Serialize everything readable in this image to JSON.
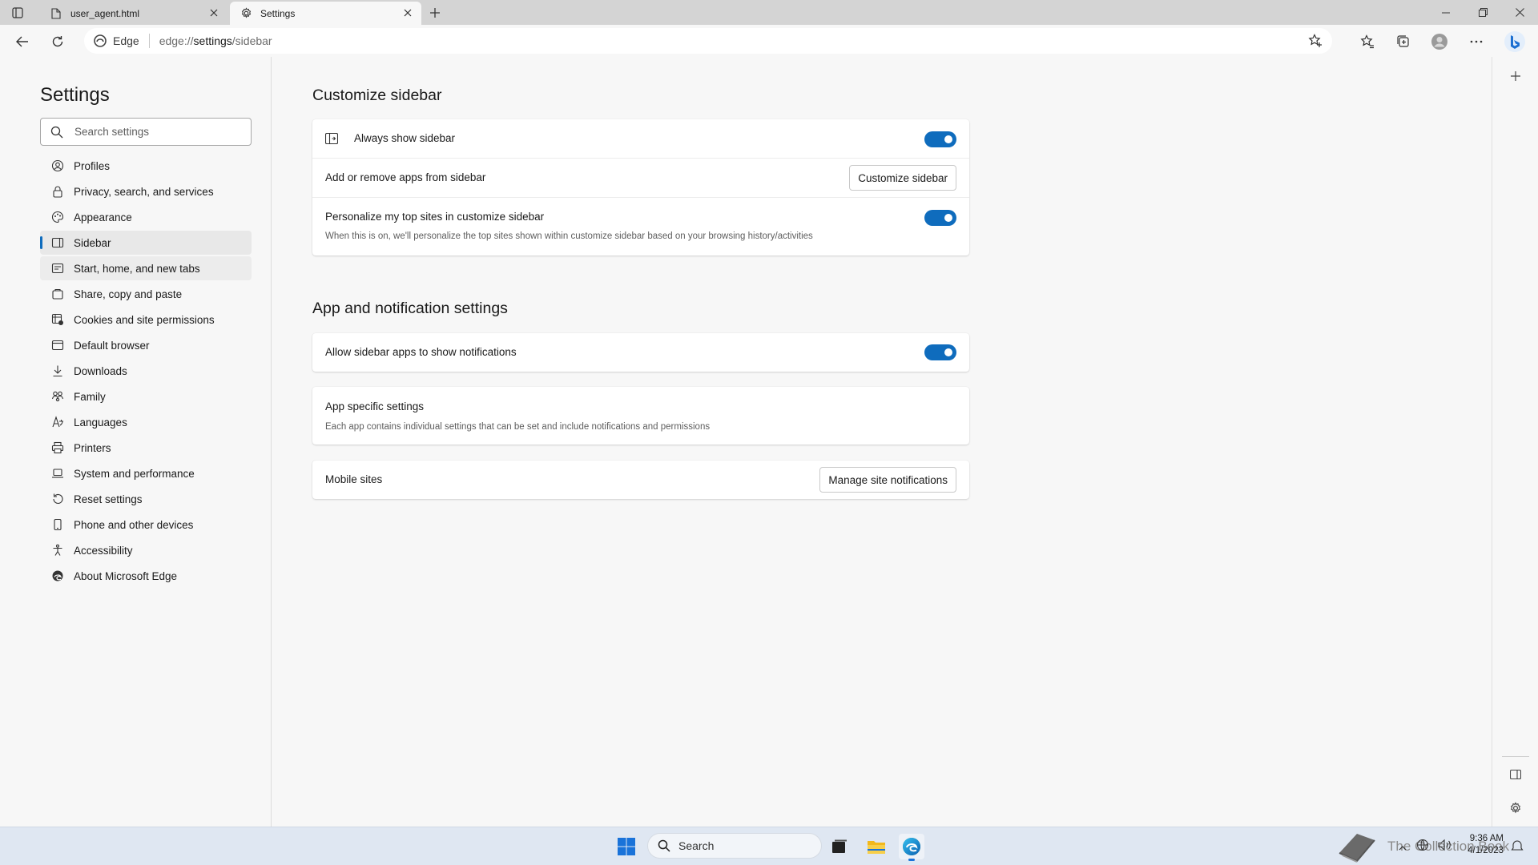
{
  "tabs": [
    {
      "title": "user_agent.html"
    },
    {
      "title": "Settings"
    }
  ],
  "toolbar": {
    "browser_label": "Edge",
    "url_prefix": "edge://",
    "url_host": "settings",
    "url_path": "/sidebar"
  },
  "nav": {
    "title": "Settings",
    "search_placeholder": "Search settings",
    "items": [
      {
        "label": "Profiles",
        "icon": "profile-icon"
      },
      {
        "label": "Privacy, search, and services",
        "icon": "lock-icon"
      },
      {
        "label": "Appearance",
        "icon": "palette-icon"
      },
      {
        "label": "Sidebar",
        "icon": "sidebar-icon"
      },
      {
        "label": "Start, home, and new tabs",
        "icon": "home-icon"
      },
      {
        "label": "Share, copy and paste",
        "icon": "share-icon"
      },
      {
        "label": "Cookies and site permissions",
        "icon": "cookie-icon"
      },
      {
        "label": "Default browser",
        "icon": "browser-icon"
      },
      {
        "label": "Downloads",
        "icon": "download-icon"
      },
      {
        "label": "Family",
        "icon": "family-icon"
      },
      {
        "label": "Languages",
        "icon": "language-icon"
      },
      {
        "label": "Printers",
        "icon": "printer-icon"
      },
      {
        "label": "System and performance",
        "icon": "laptop-icon"
      },
      {
        "label": "Reset settings",
        "icon": "reset-icon"
      },
      {
        "label": "Phone and other devices",
        "icon": "phone-icon"
      },
      {
        "label": "Accessibility",
        "icon": "accessibility-icon"
      },
      {
        "label": "About Microsoft Edge",
        "icon": "edge-icon"
      }
    ]
  },
  "main": {
    "customize": {
      "title": "Customize sidebar",
      "always_show": "Always show sidebar",
      "add_remove": "Add or remove apps from sidebar",
      "customize_button": "Customize sidebar",
      "personalize": "Personalize my top sites in customize sidebar",
      "personalize_desc": "When this is on, we'll personalize the top sites shown within customize sidebar based on your browsing history/activities"
    },
    "apps": {
      "title": "App and notification settings",
      "allow_notifications": "Allow sidebar apps to show notifications",
      "app_specific": "App specific settings",
      "app_specific_desc": "Each app contains individual settings that can be set and include notifications and permissions",
      "mobile_sites": "Mobile sites",
      "manage_button": "Manage site notifications"
    }
  },
  "taskbar": {
    "search_label": "Search",
    "time": "9:36 AM",
    "date": "4/1/2023",
    "watermark": "The Collection Book"
  },
  "colors": {
    "accent": "#0f6cbd",
    "taskbar": "#dfe7f2"
  }
}
